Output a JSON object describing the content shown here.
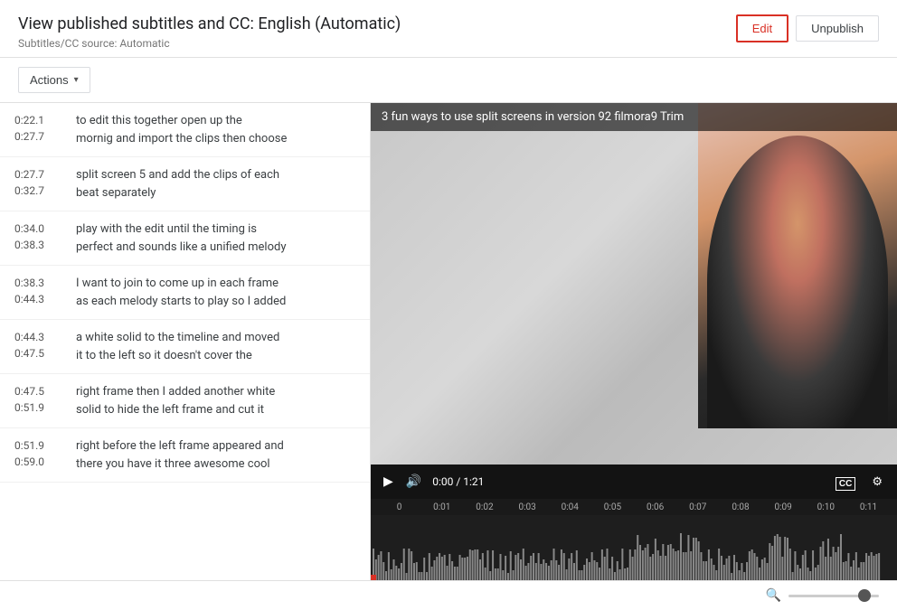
{
  "header": {
    "title": "View published subtitles and CC: English (Automatic)",
    "source": "Subtitles/CC source: Automatic",
    "edit_label": "Edit",
    "unpublish_label": "Unpublish"
  },
  "toolbar": {
    "actions_label": "Actions"
  },
  "subtitles": [
    {
      "start": "0:22.1",
      "end": "0:27.7",
      "line1": "to edit this together open up the",
      "line2": "mornig and import the clips then choose"
    },
    {
      "start": "0:27.7",
      "end": "0:32.7",
      "line1": "split screen 5 and add the clips of each",
      "line2": "beat separately"
    },
    {
      "start": "0:34.0",
      "end": "0:38.3",
      "line1": "play with the edit until the timing is",
      "line2": "perfect and sounds like a unified melody"
    },
    {
      "start": "0:38.3",
      "end": "0:44.3",
      "line1": "I want to join to come up in each frame",
      "line2": "as each melody starts to play so I added"
    },
    {
      "start": "0:44.3",
      "end": "0:47.5",
      "line1": "a white solid to the timeline and moved",
      "line2": "it to the left so it doesn't cover the"
    },
    {
      "start": "0:47.5",
      "end": "0:51.9",
      "line1": "right frame then I added another white",
      "line2": "solid to hide the left frame and cut it"
    },
    {
      "start": "0:51.9",
      "end": "0:59.0",
      "line1": "right before the left frame appeared and",
      "line2": "there you have it three awesome cool"
    }
  ],
  "video": {
    "title": "3 fun ways to use split screens in version 92 filmora9 Trim",
    "time_current": "0:00",
    "time_total": "1:21"
  },
  "timeline": {
    "marks": [
      "0",
      "0:01",
      "0:02",
      "0:03",
      "0:04",
      "0:05",
      "0:06",
      "0:07",
      "0:08",
      "0:09",
      "0:10",
      "0:11"
    ]
  },
  "zoom": {
    "icon": "🔍"
  }
}
